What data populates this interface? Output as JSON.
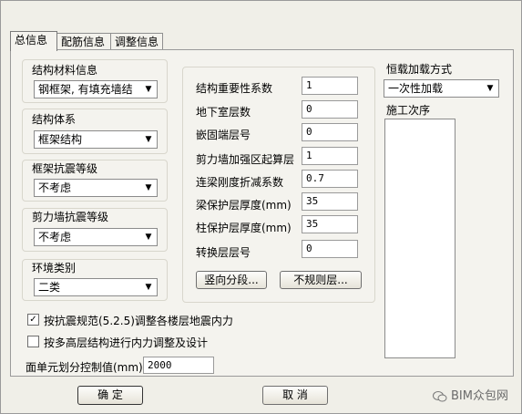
{
  "tabs": [
    "总信息",
    "配筋信息",
    "调整信息"
  ],
  "groups": {
    "material": {
      "label": "结构材料信息",
      "value": "钢框架, 有填充墙结"
    },
    "system": {
      "label": "结构体系",
      "value": "框架结构"
    },
    "frame_seismic": {
      "label": "框架抗震等级",
      "value": "不考虑"
    },
    "wall_seismic": {
      "label": "剪力墙抗震等级",
      "value": "不考虑"
    },
    "environment": {
      "label": "环境类别",
      "value": "二类"
    }
  },
  "params": [
    {
      "label": "结构重要性系数",
      "value": "1"
    },
    {
      "label": "地下室层数",
      "value": "0"
    },
    {
      "label": "嵌固端层号",
      "value": "0"
    },
    {
      "label": "剪力墙加强区起算层",
      "value": "1"
    },
    {
      "label": "连梁刚度折减系数",
      "value": "0.7"
    },
    {
      "label": "梁保护层厚度(mm)",
      "value": "35"
    },
    {
      "label": "柱保护层厚度(mm)",
      "value": "35"
    },
    {
      "label": "转换层层号",
      "value": "0"
    }
  ],
  "buttons": {
    "vertical": "竖向分段...",
    "irregular": "不规则层...",
    "ok": "确  定",
    "cancel": "取  消"
  },
  "load": {
    "label": "恒载加载方式",
    "value": "一次性加载",
    "sequence_label": "施工次序"
  },
  "checks": [
    {
      "label": "按抗震规范(5.2.5)调整各楼层地震内力",
      "checked": true
    },
    {
      "label": "按多高层结构进行内力调整及设计",
      "checked": false
    }
  ],
  "mesh": {
    "label": "面单元划分控制值(mm)",
    "value": "2000"
  },
  "watermark": "BIM众包网"
}
